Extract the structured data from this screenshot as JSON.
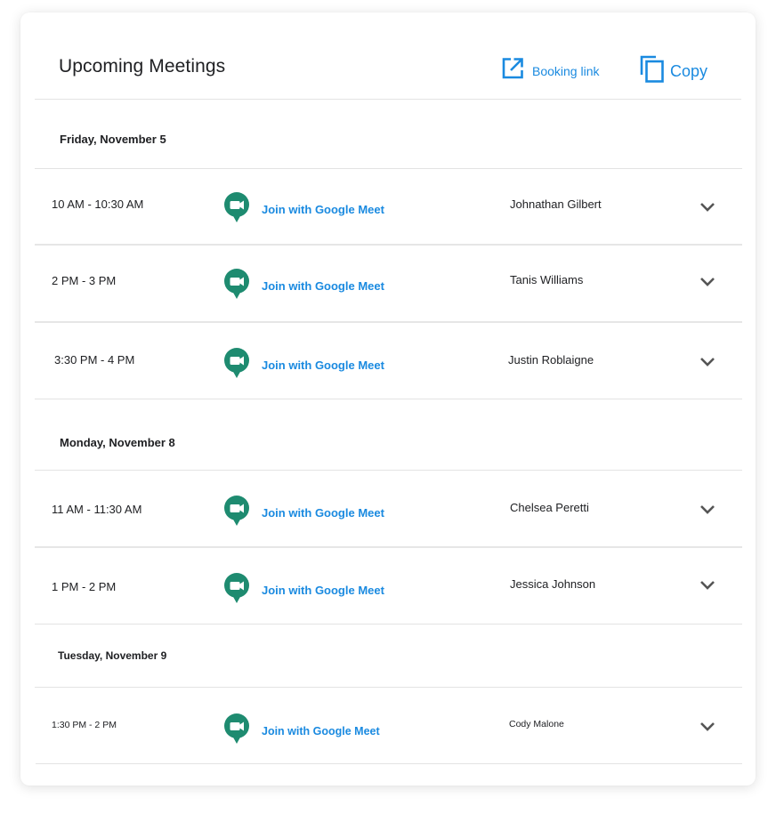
{
  "header": {
    "title": "Upcoming Meetings",
    "booking_link_label": "Booking link",
    "copy_label": "Copy"
  },
  "colors": {
    "accent": "#1a8ae0",
    "meet_green": "#1e8b70"
  },
  "days": [
    {
      "date": "Friday, November 5",
      "meetings": [
        {
          "time": "10 AM - 10:30 AM",
          "link": "Join with Google Meet",
          "person": "Johnathan Gilbert"
        },
        {
          "time": "2 PM - 3 PM",
          "link": "Join with Google Meet",
          "person": "Tanis Williams"
        },
        {
          "time": "3:30 PM - 4 PM",
          "link": "Join with Google Meet",
          "person": "Justin Roblaigne"
        }
      ]
    },
    {
      "date": "Monday, November 8",
      "meetings": [
        {
          "time": "11 AM - 11:30 AM",
          "link": "Join with Google Meet",
          "person": "Chelsea Peretti"
        },
        {
          "time": "1 PM - 2 PM",
          "link": "Join with Google Meet",
          "person": "Jessica Johnson"
        }
      ]
    },
    {
      "date": "Tuesday, November 9",
      "meetings": [
        {
          "time": "1:30 PM - 2 PM",
          "link": "Join with Google Meet",
          "person": "Cody Malone"
        }
      ]
    }
  ],
  "icons": {
    "booking": "open-in-new-icon",
    "copy": "copy-icon",
    "meet": "google-meet-icon",
    "expand": "chevron-down-icon"
  }
}
